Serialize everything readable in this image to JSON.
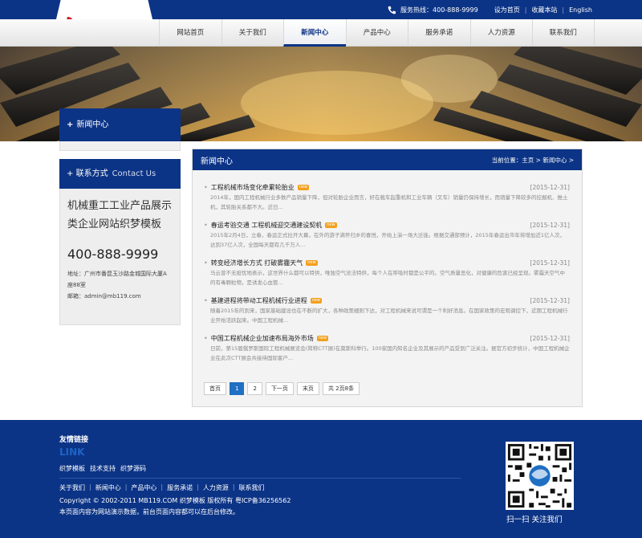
{
  "site": {
    "logo_text": "模板",
    "logo_num": "119"
  },
  "topbar": {
    "hotline": "服务热线：400-888-9999",
    "set_home": "设为首页",
    "favorite": "收藏本站",
    "english": "English"
  },
  "nav": {
    "items": [
      "网站首页",
      "关于我们",
      "新闻中心",
      "产品中心",
      "服务承诺",
      "人力资源",
      "联系我们"
    ],
    "active": 2
  },
  "sidebar": {
    "news_title": "新闻中心",
    "contact_title": "联系方式",
    "contact_en": "Contact Us",
    "company_line1": "机械重工工业产品展示",
    "company_line2": "类企业网站织梦模板",
    "phone": "400-888-9999",
    "address_line1": "地址：广州市番昆玉沙路金城国际大厦A",
    "address_line2": "座88室",
    "email": "邮箱：admin@mb119.com"
  },
  "main": {
    "title": "新闻中心",
    "breadcrumb": "当前位置：主页 > 新闻中心 >",
    "badge": "new",
    "news": [
      {
        "title": "工程机械市场变化牵累轮胎业",
        "date": "[2015-12-31]",
        "desc": "2014年，国内工程机械行业多数产品销量下降，但对轮胎企业而言，好在载车起重机和工业车辆（叉车）销量仍保持增长，而销量下降较多的挖掘机、推土机，其轮胎关系都不大。近日..."
      },
      {
        "title": "春运考验交通 工程机械迎交通建设契机",
        "date": "[2015-12-31]",
        "desc": "2015年2月4日，立春，春运正式拉开大幕，在外的游子满怀归乡的喜悦，开始上演一场大迁徙。根据交通部预计，2015年春运出市年将增加近1亿人次，达到37亿人次，全国每天都有几千万人..."
      },
      {
        "title": "转变经济增长方式 打破雾霾天气",
        "date": "[2015-12-31]",
        "desc": "马云曾不无担忧地表示，这世界什么都可以特供，唯独空气没法特供，每个人在呼吸时都是公平的。空气质量恶化，对健康的危害已经呈现。雾霾天空气中的有毒颗粒物，是诱发心血管..."
      },
      {
        "title": "基建进程将带动工程机械行业进程",
        "date": "[2015-12-31]",
        "desc": "随着2015年的到来，国家基础建设也在不断的扩大，各种政策细则下达，对工程机械来说可谓是一个利好消息。在国家政策的宏观调控下，近期工程机械行业开始活跃起来。中国工程机械..."
      },
      {
        "title": "中国工程机械企业加速布局海外市场",
        "date": "[2015-12-31]",
        "desc": "日前，第15届俄罗斯国际工程机械展览会(简称CTT展)在莫斯科举行。100家国内知名企业及其展示的产品受到广泛关注。据官方初步统计，中国工程机械企业在此次CTT展会共接待国际客户..."
      }
    ],
    "pager": [
      "首页",
      "1",
      "2",
      "下一页",
      "末页",
      "共 2页8条"
    ]
  },
  "footer": {
    "friends_title": "友情链接",
    "link_en": "LINK",
    "friends": [
      "织梦模板",
      "技术支持",
      "织梦源码"
    ],
    "nav": [
      "关于我们",
      "新闻中心",
      "产品中心",
      "服务承诺",
      "人力资源",
      "联系我们"
    ],
    "copyright": "Copyright © 2002-2011 MB119.COM 织梦模板 版权所有 粤ICP备36256562",
    "note": "本页面内容为网站演示数据，前台页面内容都可以在后台修改。",
    "qr_text": "扫一扫  关注我们"
  },
  "colors": {
    "primary": "#0c3486",
    "accent": "#1f6fc2",
    "badge": "#f2a01e"
  }
}
